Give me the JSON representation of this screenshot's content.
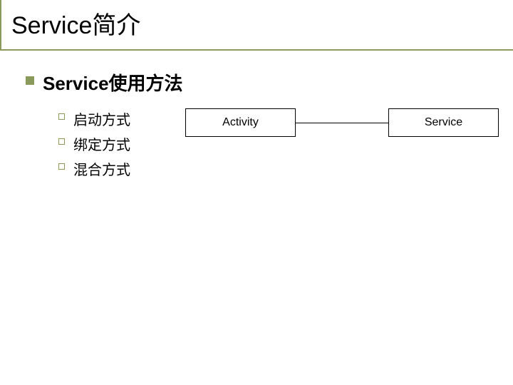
{
  "slide": {
    "title": "Service简介",
    "heading": "Service使用方法",
    "subitems": [
      {
        "text": "启动方式"
      },
      {
        "text": "绑定方式"
      },
      {
        "text": "混合方式"
      }
    ],
    "diagram": {
      "left_box": "Activity",
      "right_box": "Service"
    }
  }
}
